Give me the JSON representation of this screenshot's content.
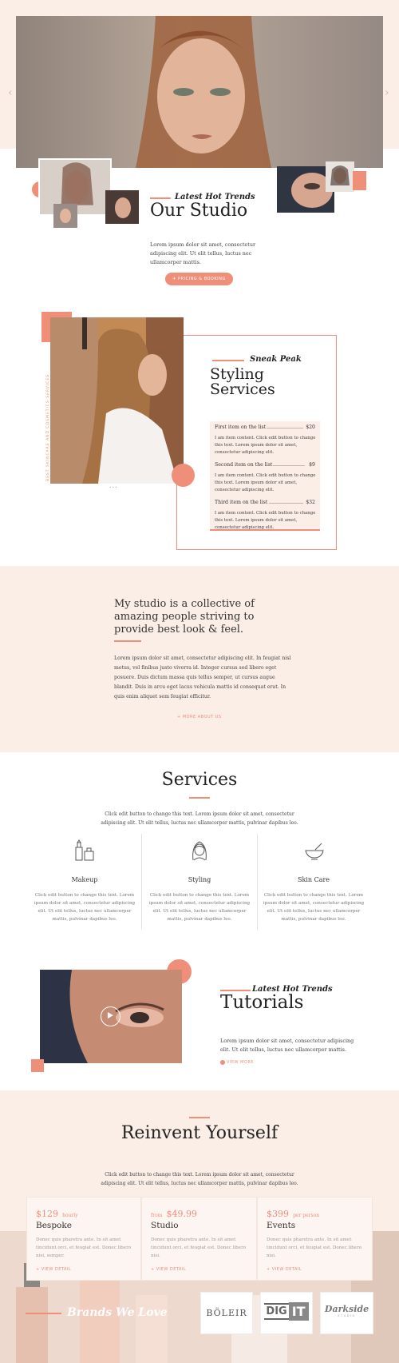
{
  "hero": {
    "arrow_left": "‹",
    "arrow_right": "›"
  },
  "studio": {
    "kicker": "Latest Hot Trends",
    "title": "Our Studio",
    "text_lines": [
      "Lorem ipsum dolor sit amet, consectetur",
      "adipiscing elit. Ut elit tellus, luctus nec",
      "ullamcorper mattis."
    ],
    "button_label": "✈ PRICING & BOOKING"
  },
  "styling": {
    "vertical_caption": "BEST SKINCARE AND COSMETICS SERVICES",
    "kicker": "Sneak Peak",
    "title_line1": "Styling",
    "title_line2": "Services",
    "dots": "• • •",
    "items": [
      {
        "title": "First item on the list",
        "price": "$20",
        "desc": [
          "I am item content. Click edit button to change",
          "this text. Lorem ipsum dolor sit amet,",
          "consectetur adipiscing elit."
        ]
      },
      {
        "title": "Second item on the list",
        "price": "$9",
        "desc": [
          "I am item content. Click edit button to change",
          "this text. Lorem ipsum dolor sit amet,",
          "consectetur adipiscing elit."
        ]
      },
      {
        "title": "Third item on the list",
        "price": "$32",
        "desc": [
          "I am item content. Click edit button to change",
          "this text. Lorem ipsum dolor sit amet,",
          "consectetur adipiscing elit."
        ]
      }
    ]
  },
  "collective": {
    "heading_lines": [
      "My studio is a collective of",
      "amazing people striving to",
      "provide best look & feel."
    ],
    "body_lines": [
      "Lorem ipsum dolor sit amet, consectetur adipiscing elit. In feugiat nisl",
      "metus, vel finibus justo viverra id. Integer cursus sed libero eget",
      "posuere. Duis dictum massa quis tellus semper, ut cursus augue",
      "blandit. Duis in arcu eget lacus vehicula mattis id consequat erat. In",
      "quis enim aliquet sem feugiat efficitur."
    ],
    "link": "+ MORE ABOUT US"
  },
  "services": {
    "title": "Services",
    "intro_lines": [
      "Click edit button to change this text. Lorem ipsum dolor sit amet, consectetur",
      "adipiscing elit. Ut elit tellus, luctus nec ullamcorper mattis, pulvinar dapibus leo."
    ],
    "columns": [
      {
        "title": "Makeup",
        "icon": "cosmetics-icon",
        "text": [
          "Click edit button to change this text. Lorem",
          "ipsum dolor sit amet, consectetur adipiscing",
          "elit. Ut elit tellus, luctus nec ullamcorper",
          "mattis, pulvinar dapibus leo."
        ]
      },
      {
        "title": "Styling",
        "icon": "woman-face-icon",
        "text": [
          "Click edit button to change this text. Lorem",
          "ipsum dolor sit amet, consectetur adipiscing",
          "elit. Ut elit tellus, luctus nec ullamcorper",
          "mattis, pulvinar dapibus leo."
        ]
      },
      {
        "title": "Skin Care",
        "icon": "mortar-pestle-icon",
        "text": [
          "Click edit button to change this text. Lorem",
          "ipsum dolor sit amet, consectetur adipiscing",
          "elit. Ut elit tellus, luctus nec ullamcorper",
          "mattis, pulvinar dapibus leo."
        ]
      }
    ]
  },
  "tutorials": {
    "kicker": "Latest Hot Trends",
    "title": "Tutorials",
    "text_lines": [
      "Lorem ipsum dolor sit amet, consectetur adipiscing",
      "elit. Ut elit tellus, luctus nec ullamcorper mattis."
    ],
    "link": "VIEW MORE"
  },
  "reinvent": {
    "title": "Reinvent Yourself",
    "intro_lines": [
      "Click edit button to change this text. Lorem ipsum dolor sit amet, consectetur",
      "adipiscing elit. Ut elit tellus, luctus nec ullamcorper mattis, pulvinar dapibus leo."
    ],
    "cards": [
      {
        "prefix": "",
        "price": "$129",
        "suffix": "hourly",
        "name": "Bespoke",
        "text": [
          "Donec quis pharetra ante. In sit amet",
          "tincidunt orci, et feugiat est. Donec libero",
          "nisi, semper."
        ],
        "link": "+ VIEW DETAIL"
      },
      {
        "prefix": "from",
        "price": "$49.99",
        "suffix": "",
        "name": "Studio",
        "text": [
          "Donec quis pharetra ante. In sit amet",
          "tincidunt orci, et feugiat est. Donec libero",
          "nisi."
        ],
        "link": "+ VIEW DETAIL"
      },
      {
        "prefix": "",
        "price": "$399",
        "suffix": "per person",
        "name": "Events",
        "text": [
          "Donec quis pharetra ante. In sit amet",
          "tincidunt orci, et feugiat est. Donec libero",
          "nisi."
        ],
        "link": "+ VIEW DETAIL"
      }
    ]
  },
  "brands": {
    "title": "Brands We Love",
    "logos": [
      "BÖLEIR",
      "DIG",
      "IT",
      "Darkside",
      "STUDIO"
    ]
  },
  "colors": {
    "accent": "#ef8e79",
    "blush": "#fbeee7"
  }
}
